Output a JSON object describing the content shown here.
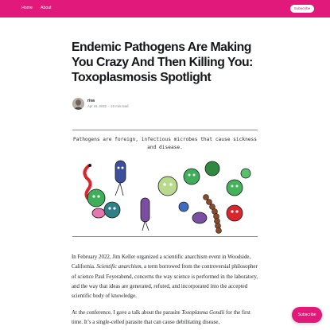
{
  "header": {
    "nav": [
      {
        "label": "Home"
      },
      {
        "label": "About"
      }
    ],
    "subscribe_label": "Subscribe",
    "background": "#e0197a"
  },
  "article": {
    "title": "Endemic Pathogens Are Making You Crazy And Then Killing You: Toxoplasmosis Spotlight",
    "author": "riva",
    "date": "Apr 18, 2022",
    "reading_time": "22 min read",
    "hero_caption": "Pathogens are foreign, infectious microbes that cause sickness and disease.",
    "paragraphs": [
      {
        "before": "In February 2022, Jim Keller organized a scientific anarchism event in Woodside, California. ",
        "em": "Scientific anarchism",
        "after": ", a term borrowed from the controversial philosopher of science Paul Feyerabend, concerns the way science is performed in the laboratory, and the way that ideas are generated, refuted, and incorporated into the accepted scientific body of knowledge."
      },
      {
        "before": "At the conference, I gave a talk about the parasite ",
        "em": "Toxoplasma Gondii",
        "after": " for the first time. It’s a single-celled parasite that can cause debilitating disease,"
      }
    ]
  },
  "floating_subscribe_label": "Subscribe"
}
